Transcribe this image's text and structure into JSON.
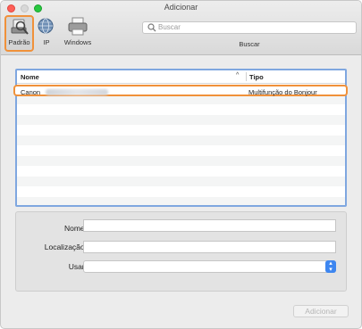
{
  "window": {
    "title": "Adicionar"
  },
  "toolbar": {
    "tools": [
      {
        "label": "Padrão",
        "icon": "default-printer-icon"
      },
      {
        "label": "IP",
        "icon": "globe-icon"
      },
      {
        "label": "Windows",
        "icon": "windows-printer-icon"
      }
    ],
    "search": {
      "placeholder": "Buscar",
      "label": "Buscar"
    }
  },
  "list": {
    "columns": {
      "name": "Nome",
      "type": "Tipo"
    },
    "rows": [
      {
        "name": "Canon",
        "type": "Multifunção do Bonjour"
      }
    ]
  },
  "form": {
    "name_label": "Nome:",
    "location_label": "Localização:",
    "use_label": "Usar:"
  },
  "actions": {
    "add_label": "Adicionar"
  },
  "colors": {
    "highlight": "#f0913a",
    "selection_blue": "#7fa7e0",
    "accent": "#3d86f0"
  }
}
